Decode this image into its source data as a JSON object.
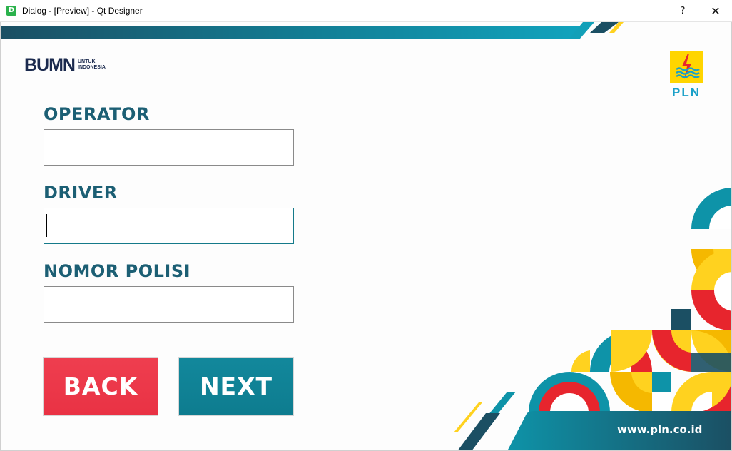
{
  "window": {
    "app_icon_letter": "D",
    "title": "Dialog - [Preview] - Qt Designer",
    "help_glyph": "?",
    "close_glyph": "✕"
  },
  "logos": {
    "bumn": {
      "main": "BUMN",
      "sub_line1": "UNTUK",
      "sub_line2": "INDONESIA"
    },
    "pln": {
      "text": "PLN"
    }
  },
  "form": {
    "operator": {
      "label": "OPERATOR",
      "value": ""
    },
    "driver": {
      "label": "DRIVER",
      "value": ""
    },
    "nomor_polisi": {
      "label": "NOMOR POLISI",
      "value": ""
    }
  },
  "buttons": {
    "back": "BACK",
    "next": "NEXT"
  },
  "footer": {
    "url": "www.pln.co.id"
  },
  "colors": {
    "label": "#1c5f74",
    "back_button": "#e93244",
    "next_button": "#0e7c8f",
    "accent_teal": "#0e93a8",
    "accent_yellow": "#ffd21f",
    "accent_red": "#e7252d",
    "dark_navy": "#1b4f63"
  }
}
